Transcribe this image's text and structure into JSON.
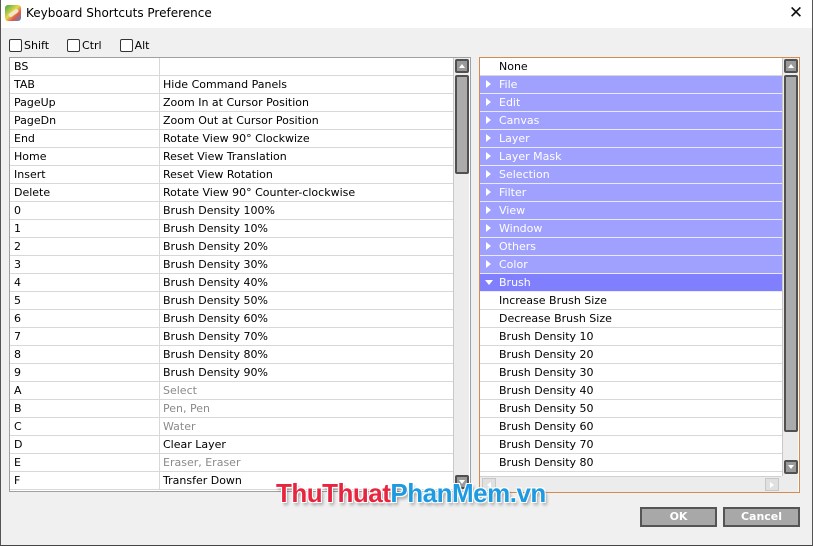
{
  "window": {
    "title": "Keyboard Shortcuts Preference",
    "close_glyph": "✕"
  },
  "modifiers": [
    {
      "label": "Shift",
      "checked": false
    },
    {
      "label": "Ctrl",
      "checked": false
    },
    {
      "label": "Alt",
      "checked": false
    }
  ],
  "shortcuts": [
    {
      "key": "BS",
      "action": "",
      "dim": false
    },
    {
      "key": "TAB",
      "action": "Hide Command Panels",
      "dim": false
    },
    {
      "key": "PageUp",
      "action": "Zoom In at Cursor Position",
      "dim": false
    },
    {
      "key": "PageDn",
      "action": "Zoom Out at Cursor Position",
      "dim": false
    },
    {
      "key": "End",
      "action": "Rotate View 90° Clockwize",
      "dim": false
    },
    {
      "key": "Home",
      "action": "Reset View Translation",
      "dim": false
    },
    {
      "key": "Insert",
      "action": "Reset View Rotation",
      "dim": false
    },
    {
      "key": "Delete",
      "action": "Rotate View 90° Counter-clockwise",
      "dim": false
    },
    {
      "key": "0",
      "action": "Brush Density 100%",
      "dim": false
    },
    {
      "key": "1",
      "action": "Brush Density 10%",
      "dim": false
    },
    {
      "key": "2",
      "action": "Brush Density 20%",
      "dim": false
    },
    {
      "key": "3",
      "action": "Brush Density 30%",
      "dim": false
    },
    {
      "key": "4",
      "action": "Brush Density 40%",
      "dim": false
    },
    {
      "key": "5",
      "action": "Brush Density 50%",
      "dim": false
    },
    {
      "key": "6",
      "action": "Brush Density 60%",
      "dim": false
    },
    {
      "key": "7",
      "action": "Brush Density 70%",
      "dim": false
    },
    {
      "key": "8",
      "action": "Brush Density 80%",
      "dim": false
    },
    {
      "key": "9",
      "action": "Brush Density 90%",
      "dim": false
    },
    {
      "key": "A",
      "action": "Select",
      "dim": true
    },
    {
      "key": "B",
      "action": "Pen, Pen",
      "dim": true
    },
    {
      "key": "C",
      "action": "Water",
      "dim": true
    },
    {
      "key": "D",
      "action": "Clear Layer",
      "dim": false
    },
    {
      "key": "E",
      "action": "Eraser, Eraser",
      "dim": true
    },
    {
      "key": "F",
      "action": "Transfer Down",
      "dim": false
    }
  ],
  "command_tree": [
    {
      "label": "None",
      "type": "item"
    },
    {
      "label": "File",
      "type": "category",
      "expanded": false
    },
    {
      "label": "Edit",
      "type": "category",
      "expanded": false
    },
    {
      "label": "Canvas",
      "type": "category",
      "expanded": false
    },
    {
      "label": "Layer",
      "type": "category",
      "expanded": false
    },
    {
      "label": "Layer Mask",
      "type": "category",
      "expanded": false
    },
    {
      "label": "Selection",
      "type": "category",
      "expanded": false
    },
    {
      "label": "Filter",
      "type": "category",
      "expanded": false
    },
    {
      "label": "View",
      "type": "category",
      "expanded": false
    },
    {
      "label": "Window",
      "type": "category",
      "expanded": false
    },
    {
      "label": "Others",
      "type": "category",
      "expanded": false
    },
    {
      "label": "Color",
      "type": "category",
      "expanded": false
    },
    {
      "label": "Brush",
      "type": "category",
      "expanded": true
    },
    {
      "label": "Increase Brush Size",
      "type": "item"
    },
    {
      "label": "Decrease Brush Size",
      "type": "item"
    },
    {
      "label": "Brush Density 10",
      "type": "item"
    },
    {
      "label": "Brush Density 20",
      "type": "item"
    },
    {
      "label": "Brush Density 30",
      "type": "item"
    },
    {
      "label": "Brush Density 40",
      "type": "item"
    },
    {
      "label": "Brush Density 50",
      "type": "item"
    },
    {
      "label": "Brush Density 60",
      "type": "item"
    },
    {
      "label": "Brush Density 70",
      "type": "item"
    },
    {
      "label": "Brush Density 80",
      "type": "item"
    }
  ],
  "buttons": {
    "ok": "OK",
    "cancel": "Cancel"
  },
  "watermark": {
    "part1": "ThuThuat",
    "part2": "PhanMem.vn"
  },
  "colors": {
    "category_bg": "#a0a0ff",
    "category_open_bg": "#8080ff",
    "tree_border": "#d58a4e",
    "button_bg": "#a8a8a8"
  }
}
